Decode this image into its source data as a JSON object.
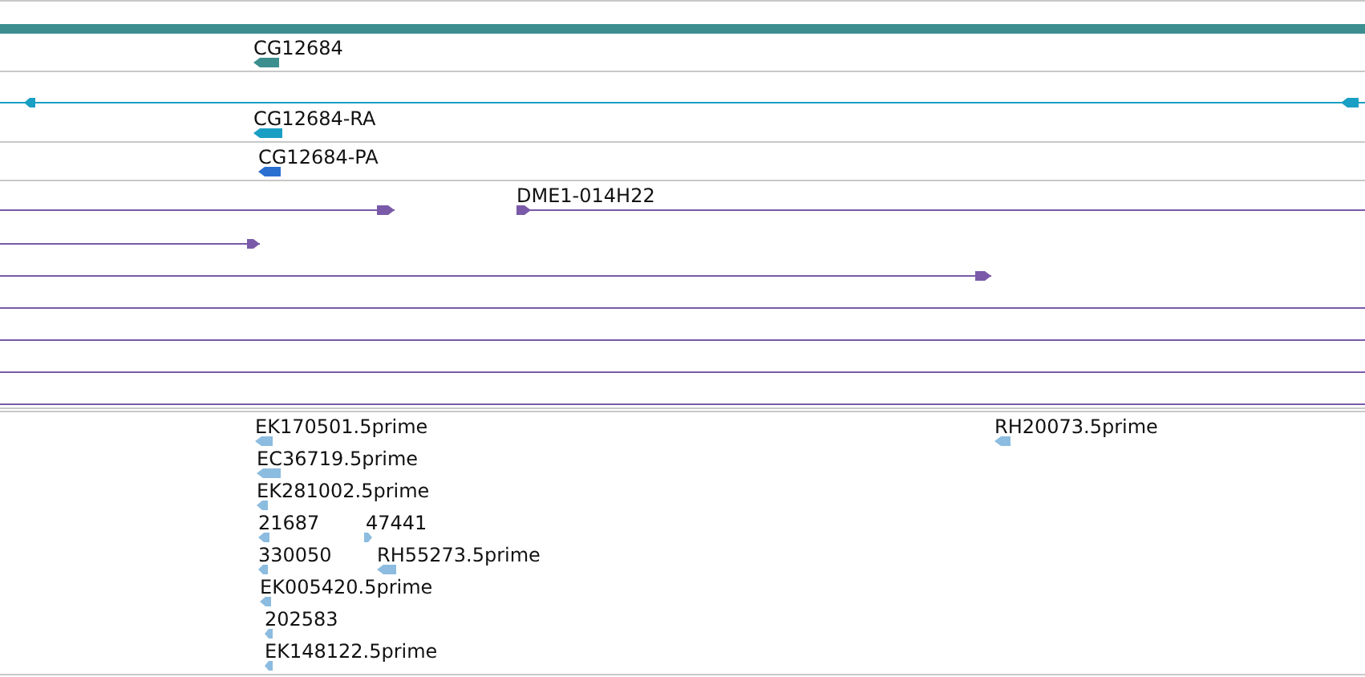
{
  "tracks": [
    {
      "kind": "gene",
      "features": [
        {
          "kind": "plain"
        },
        {
          "label": "CG12684",
          "kind": "reverse"
        }
      ]
    },
    {
      "kind": "transcript",
      "features": [
        {
          "kind": "reverse"
        },
        {
          "label": "CG12684-RA",
          "kind": "reverse"
        }
      ]
    },
    {
      "kind": "protein",
      "features": [
        {
          "label": "CG12684-PA",
          "kind": "reverse"
        }
      ]
    },
    {
      "kind": "clone",
      "features": [
        {
          "kind": "forward"
        },
        {
          "label": "DME1-014H22",
          "kind": "forward"
        },
        {
          "kind": "forward"
        },
        {
          "kind": "forward"
        },
        {
          "kind": "plain"
        },
        {
          "kind": "plain"
        },
        {
          "kind": "plain"
        },
        {
          "kind": "plain"
        }
      ]
    },
    {
      "kind": "est",
      "features": [
        {
          "label": "EK170501.5prime",
          "kind": "reverse"
        },
        {
          "label": "RH20073.5prime",
          "kind": "reverse"
        },
        {
          "label": "EC36719.5prime",
          "kind": "reverse"
        },
        {
          "label": "EK281002.5prime",
          "kind": "reverse"
        },
        {
          "label": "21687",
          "kind": "reverse"
        },
        {
          "label": "47441",
          "kind": "forward"
        },
        {
          "label": "330050",
          "kind": "reverse"
        },
        {
          "label": "RH55273.5prime",
          "kind": "reverse"
        },
        {
          "label": "EK005420.5prime",
          "kind": "reverse"
        },
        {
          "label": "202583",
          "kind": "reverse"
        },
        {
          "label": "EK148122.5prime",
          "kind": "reverse"
        }
      ]
    }
  ]
}
